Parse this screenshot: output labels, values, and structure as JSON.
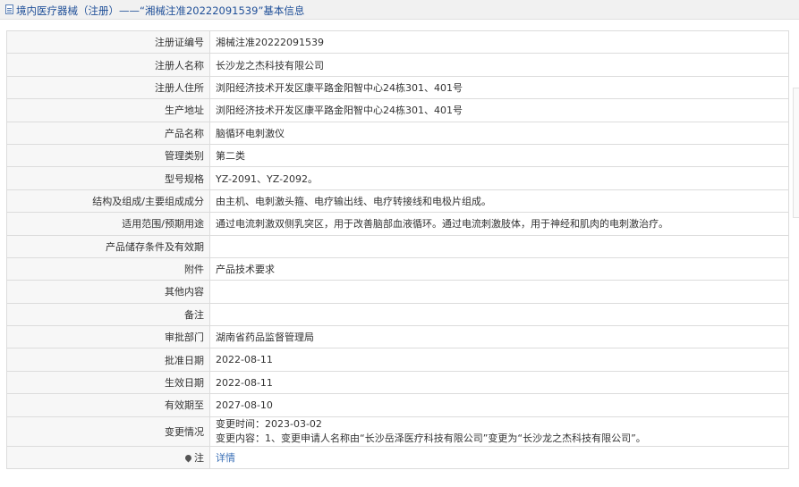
{
  "page": {
    "title": "境内医疗器械（注册）——“湘械注准20222091539”基本信息"
  },
  "rows": [
    {
      "label": "注册证编号",
      "value": "湘械注准20222091539"
    },
    {
      "label": "注册人名称",
      "value": "长沙龙之杰科技有限公司"
    },
    {
      "label": "注册人住所",
      "value": "浏阳经济技术开发区康平路金阳智中心24栋301、401号"
    },
    {
      "label": "生产地址",
      "value": "浏阳经济技术开发区康平路金阳智中心24栋301、401号"
    },
    {
      "label": "产品名称",
      "value": "脑循环电刺激仪"
    },
    {
      "label": "管理类别",
      "value": "第二类"
    },
    {
      "label": "型号规格",
      "value": "YZ-2091、YZ-2092。"
    },
    {
      "label": "结构及组成/主要组成成分",
      "value": "由主机、电刺激头箍、电疗输出线、电疗转接线和电极片组成。"
    },
    {
      "label": "适用范围/预期用途",
      "value": "通过电流刺激双侧乳突区，用于改善脑部血液循环。通过电流刺激肢体，用于神经和肌肉的电刺激治疗。"
    },
    {
      "label": "产品储存条件及有效期",
      "value": ""
    },
    {
      "label": "附件",
      "value": "产品技术要求"
    },
    {
      "label": "其他内容",
      "value": ""
    },
    {
      "label": "备注",
      "value": ""
    },
    {
      "label": "审批部门",
      "value": "湖南省药品监督管理局"
    },
    {
      "label": "批准日期",
      "value": "2022-08-11"
    },
    {
      "label": "生效日期",
      "value": "2022-08-11"
    },
    {
      "label": "有效期至",
      "value": "2027-08-10"
    }
  ],
  "change": {
    "label": "变更情况",
    "line1": "变更时间：2023-03-02",
    "line2": "变更内容：1、变更申请人名称由“长沙岳泽医疗科技有限公司”变更为“长沙龙之杰科技有限公司”。"
  },
  "note": {
    "label": "注",
    "icon": "pin-icon",
    "link_text": "详情"
  }
}
